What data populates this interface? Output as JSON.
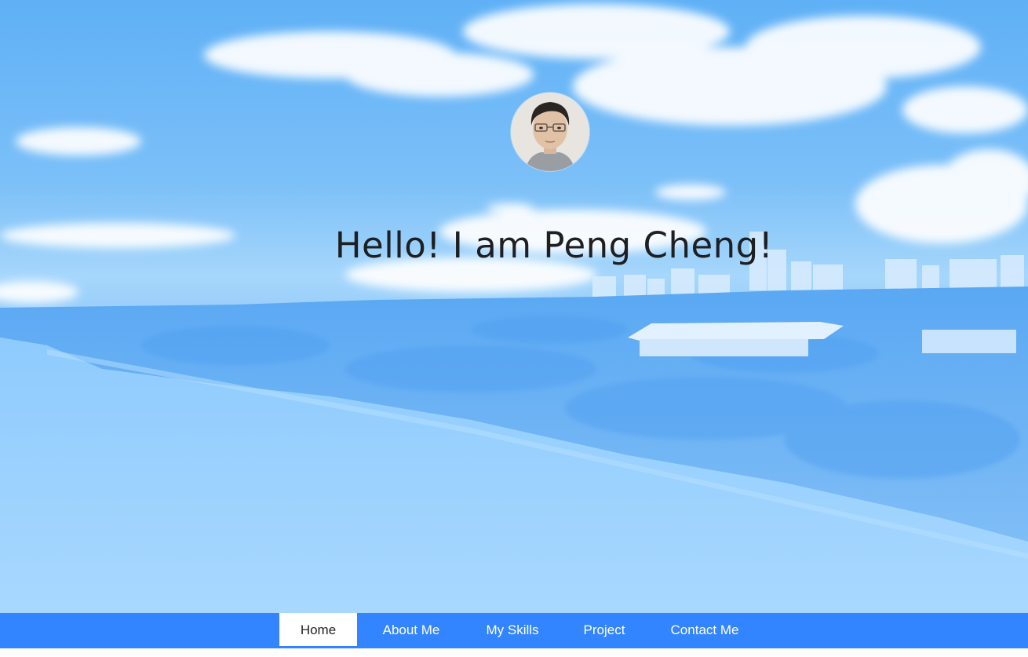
{
  "hero": {
    "greeting": "Hello! I am Peng Cheng!"
  },
  "avatar": {
    "icon": "profile-photo"
  },
  "nav": {
    "items": [
      {
        "label": "Home",
        "active": true
      },
      {
        "label": "About Me",
        "active": false
      },
      {
        "label": "My Skills",
        "active": false
      },
      {
        "label": "Project",
        "active": false
      },
      {
        "label": "Contact Me",
        "active": false
      }
    ]
  },
  "colors": {
    "nav_background": "#3385ff",
    "nav_active_background": "#ffffff",
    "nav_text": "#ffffff",
    "greeting_text": "#1d1f22",
    "sky": "#6fb8f7"
  }
}
